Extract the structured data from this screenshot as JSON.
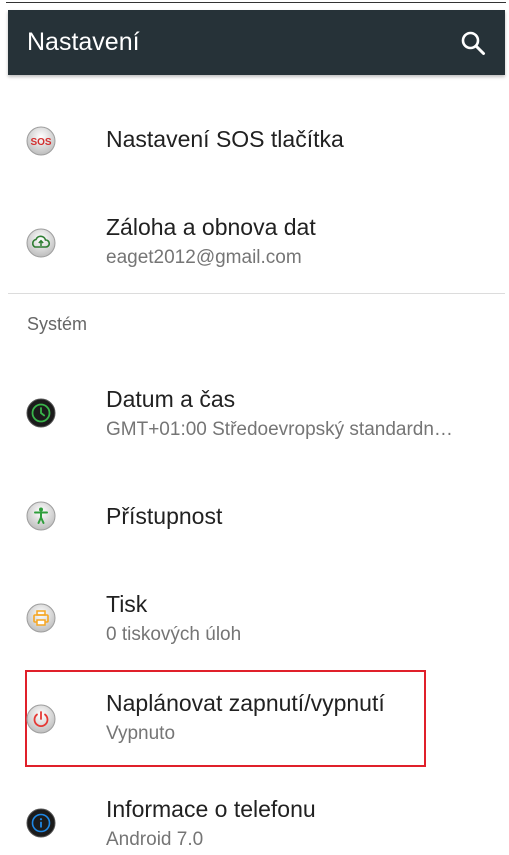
{
  "app_bar": {
    "title": "Nastavení",
    "search_icon": "search-icon",
    "background": "#263238"
  },
  "items_top": [
    {
      "title": "Nastavení SOS tlačítka",
      "icon": "sos-icon",
      "icon_text": "SOS"
    },
    {
      "title": "Záloha a obnova dat",
      "subtitle": "eaget2012@gmail.com",
      "icon": "cloud-backup-icon"
    }
  ],
  "section": {
    "title": "Systém"
  },
  "items_system": [
    {
      "title": "Datum a čas",
      "subtitle": "GMT+01:00 Středoevropský standardn…",
      "icon": "clock-icon"
    },
    {
      "title": "Přístupnost",
      "icon": "accessibility-icon"
    },
    {
      "title": "Tisk",
      "subtitle": "0 tiskových úloh",
      "icon": "printer-icon"
    },
    {
      "title": "Naplánovat zapnutí/vypnutí",
      "subtitle": "Vypnuto",
      "icon": "power-icon",
      "highlighted": true
    },
    {
      "title": "Informace o telefonu",
      "subtitle": "Android 7.0",
      "icon": "info-icon"
    }
  ],
  "colors": {
    "highlight_border": "#e0202a",
    "sos_red": "#d32f2f",
    "cloud_green": "#2e7d32",
    "accessibility_green": "#2e9e3b",
    "printer_orange": "#f5a623",
    "power_red": "#e53935",
    "info_blue": "#1e88e5"
  }
}
